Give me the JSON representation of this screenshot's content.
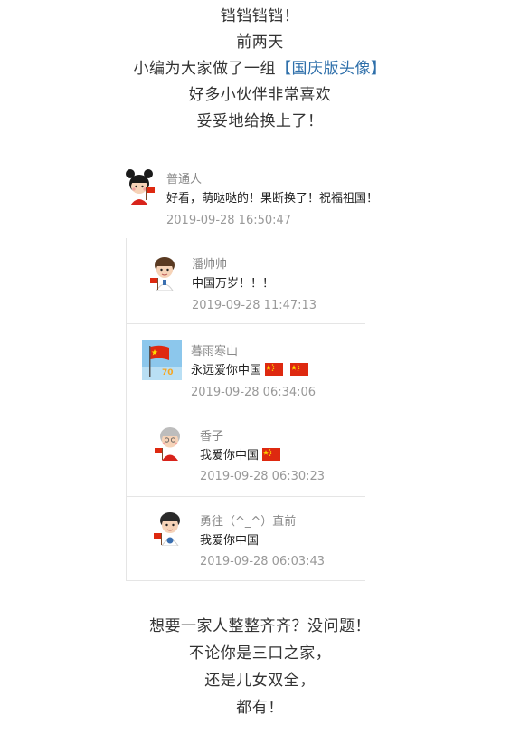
{
  "intro": {
    "line1": "铛铛铛铛！",
    "line2": "前两天",
    "line3_prefix": "小编为大家做了一组",
    "line3_highlight": "【国庆版头像】",
    "line4": "好多小伙伴非常喜欢",
    "line5": "妥妥地给换上了！"
  },
  "comments": [
    {
      "name": "普通人",
      "text": "好看，萌哒哒的！果断换了！祝福祖国！",
      "time": "2019-09-28 16:50:47",
      "avatar": "girl-avatar-icon"
    },
    {
      "name": "潘帅帅",
      "text": "中国万岁！！！",
      "time": "2019-09-28 11:47:13",
      "avatar": "boy-avatar-icon"
    },
    {
      "name": "暮雨寒山",
      "text": "永远爱你中国",
      "time": "2019-09-28 06:34:06",
      "avatar": "flag-70-avatar-icon"
    },
    {
      "name": "香子",
      "text": "我爱你中国",
      "time": "2019-09-28 06:30:23",
      "avatar": "grandma-avatar-icon"
    },
    {
      "name": "勇往（^_^）直前",
      "text": "我爱你中国",
      "time": "2019-09-28 06:03:43",
      "avatar": "boy-glasses-avatar-icon"
    }
  ],
  "outro": {
    "line1": "想要一家人整整齐齐？没问题！",
    "line2": "不论你是三口之家，",
    "line3": "还是儿女双全，",
    "line4": "都有！"
  },
  "colors": {
    "highlight": "#2e6faa",
    "flag_red": "#de2910",
    "flag_yellow": "#ffde00"
  }
}
